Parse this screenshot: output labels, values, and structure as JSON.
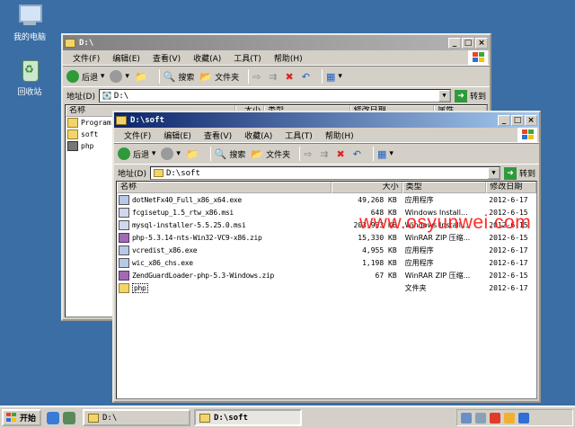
{
  "desktop": {
    "icons": [
      {
        "label": "我的电脑",
        "icon": "my-computer-icon"
      },
      {
        "label": "回收站",
        "icon": "recycle-bin-icon"
      }
    ]
  },
  "back_window": {
    "title": "D:\\",
    "menu": [
      "文件(F)",
      "编辑(E)",
      "查看(V)",
      "收藏(A)",
      "工具(T)",
      "帮助(H)"
    ],
    "toolbar": {
      "back": "后退",
      "search": "搜索",
      "folders": "文件夹"
    },
    "address_label": "地址(D)",
    "address_value": "D:\\",
    "go": "转到",
    "columns": [
      "名称",
      "大小",
      "类型",
      "修改日期",
      "属性"
    ],
    "tree": [
      "Program",
      "soft",
      "php"
    ]
  },
  "front_window": {
    "title": "D:\\soft",
    "menu": [
      "文件(F)",
      "编辑(E)",
      "查看(V)",
      "收藏(A)",
      "工具(T)",
      "帮助(H)"
    ],
    "toolbar": {
      "back": "后退",
      "search": "搜索",
      "folders": "文件夹"
    },
    "address_label": "地址(D)",
    "address_value": "D:\\soft",
    "go": "转到",
    "columns": {
      "name": "名称",
      "size": "大小",
      "type": "类型",
      "date": "修改日期"
    },
    "files": [
      {
        "name": "dotNetFx40_Full_x86_x64.exe",
        "size": "49,268 KB",
        "type": "应用程序",
        "date": "2012-6-17",
        "icon": "exe"
      },
      {
        "name": "fcgisetup_1.5_rtw_x86.msi",
        "size": "648 KB",
        "type": "Windows Install...",
        "date": "2012-6-15",
        "icon": "msi"
      },
      {
        "name": "mysql-installer-5.5.25.0.msi",
        "size": "203,933 KB",
        "type": "Windows Install...",
        "date": "2012-6-15",
        "icon": "msi"
      },
      {
        "name": "php-5.3.14-nts-Win32-VC9-x86.zip",
        "size": "15,330 KB",
        "type": "WinRAR ZIP 压缩...",
        "date": "2012-6-15",
        "icon": "zip"
      },
      {
        "name": "vcredist_x86.exe",
        "size": "4,955 KB",
        "type": "应用程序",
        "date": "2012-6-17",
        "icon": "exe"
      },
      {
        "name": "wic_x86_chs.exe",
        "size": "1,198 KB",
        "type": "应用程序",
        "date": "2012-6-17",
        "icon": "exe"
      },
      {
        "name": "ZendGuardLoader-php-5.3-Windows.zip",
        "size": "67 KB",
        "type": "WinRAR ZIP 压缩...",
        "date": "2012-6-15",
        "icon": "zip"
      },
      {
        "name": "php",
        "size": "",
        "type": "文件夹",
        "date": "2012-6-17",
        "icon": "folder"
      }
    ]
  },
  "watermark": "www.osyunwei.com",
  "taskbar": {
    "start": "开始",
    "tasks": [
      "D:\\",
      "D:\\soft"
    ]
  }
}
